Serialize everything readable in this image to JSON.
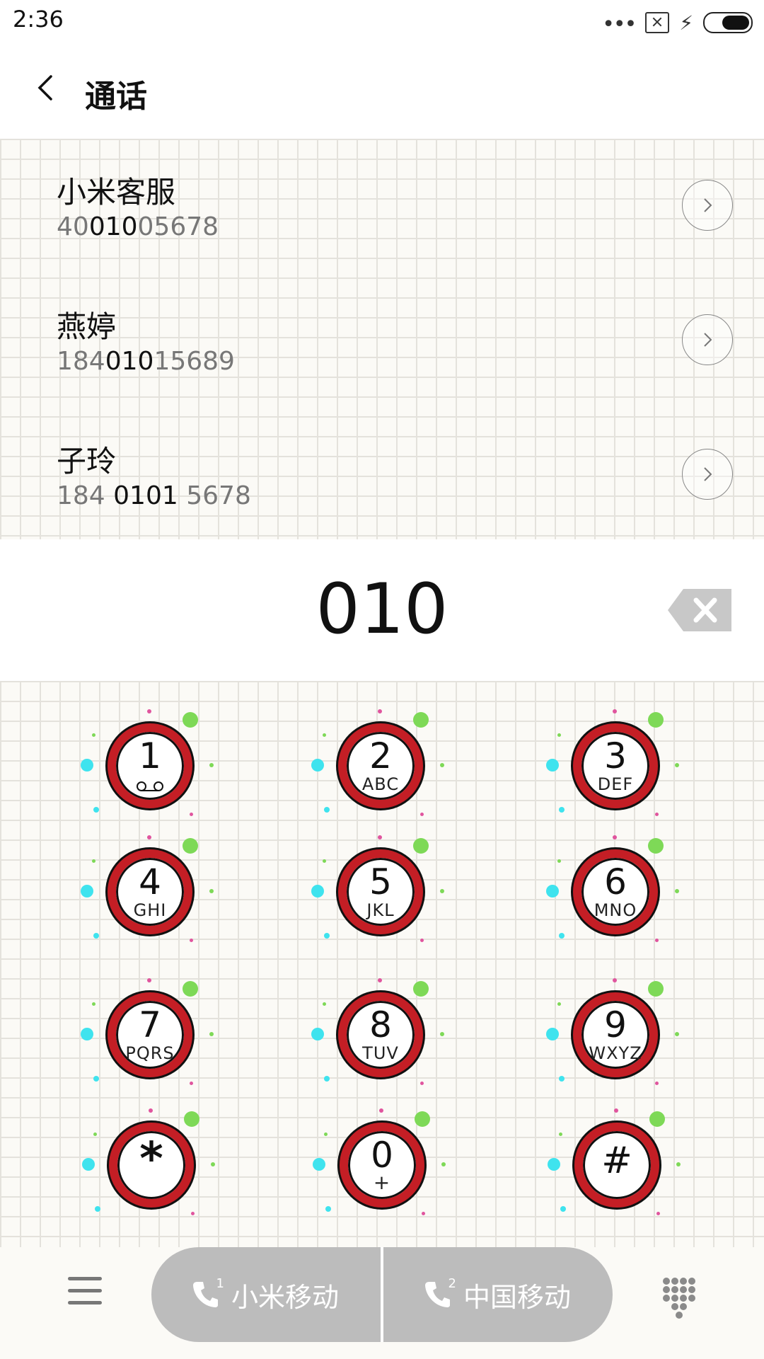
{
  "status_bar": {
    "time": "2:36"
  },
  "header": {
    "title": "通话"
  },
  "contacts": [
    {
      "name": "小米客服",
      "number_parts": [
        "40",
        "010",
        "05678"
      ]
    },
    {
      "name": "燕婷",
      "number_parts": [
        "184",
        "010",
        "15689"
      ]
    },
    {
      "name": "子玲",
      "number_parts": [
        "184 ",
        "0101",
        " 5678"
      ]
    }
  ],
  "dial_input": "010",
  "keys": [
    {
      "digit": "1",
      "letters": ""
    },
    {
      "digit": "2",
      "letters": "ABC"
    },
    {
      "digit": "3",
      "letters": "DEF"
    },
    {
      "digit": "4",
      "letters": "GHI"
    },
    {
      "digit": "5",
      "letters": "JKL"
    },
    {
      "digit": "6",
      "letters": "MNO"
    },
    {
      "digit": "7",
      "letters": "PQRS"
    },
    {
      "digit": "8",
      "letters": "TUV"
    },
    {
      "digit": "9",
      "letters": "WXYZ"
    },
    {
      "digit": "*",
      "letters": ""
    },
    {
      "digit": "0",
      "letters": "+"
    },
    {
      "digit": "#",
      "letters": ""
    }
  ],
  "call_buttons": {
    "sim1_label": "小米移动",
    "sim2_label": "中国移动",
    "sim1_index": "1",
    "sim2_index": "2"
  },
  "colors": {
    "ring": "#c41e25",
    "dot_green": "#7ed957",
    "dot_cyan": "#3fe3ee",
    "dot_pink": "#e0559e"
  }
}
